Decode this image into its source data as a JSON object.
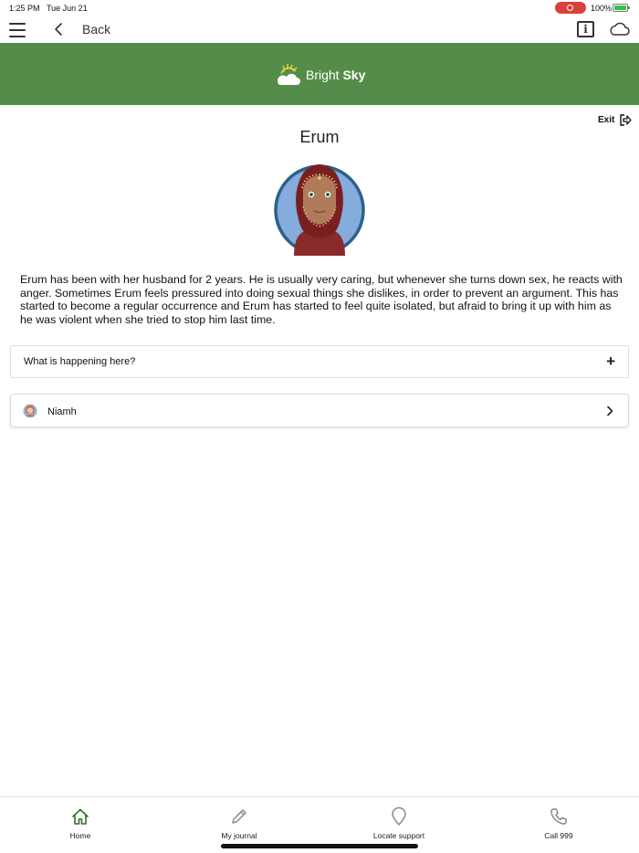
{
  "status_bar": {
    "time": "1:25 PM",
    "date": "Tue Jun 21",
    "battery": "100%"
  },
  "nav": {
    "back_label": "Back",
    "icons": [
      "menu-icon",
      "chevron-left-icon",
      "info-icon",
      "cloud-icon"
    ]
  },
  "header": {
    "brand_regular": "Bright",
    "brand_bold": "Sky",
    "background_color": "#548d4a"
  },
  "exit_label": "Exit",
  "person": {
    "name": "Erum",
    "story": "Erum has been with her husband for 2 years. He is usually very caring, but whenever she turns down sex, he reacts with anger. Sometimes Erum feels pressured into doing sexual things she dislikes, in order to prevent an argument. This has started to become a regular occurrence and Erum has started to feel quite isolated, but afraid to bring it up with him as he was violent when she tried to stop him last time."
  },
  "accordion": {
    "label": "What is happening here?",
    "icon": "plus-icon"
  },
  "related": {
    "label": "Niamh",
    "icon": "chevron-right-icon"
  },
  "tabs": [
    {
      "label": "Home",
      "icon": "home-icon",
      "active": true
    },
    {
      "label": "My journal",
      "icon": "pencil-icon",
      "active": false
    },
    {
      "label": "Locate support",
      "icon": "location-pin-icon",
      "active": false
    },
    {
      "label": "Call 999",
      "icon": "phone-icon",
      "active": false
    }
  ],
  "colors": {
    "brand_green": "#548d4a",
    "active_tab": "#2f6b2a",
    "inactive_tab": "#8a8a8a"
  }
}
